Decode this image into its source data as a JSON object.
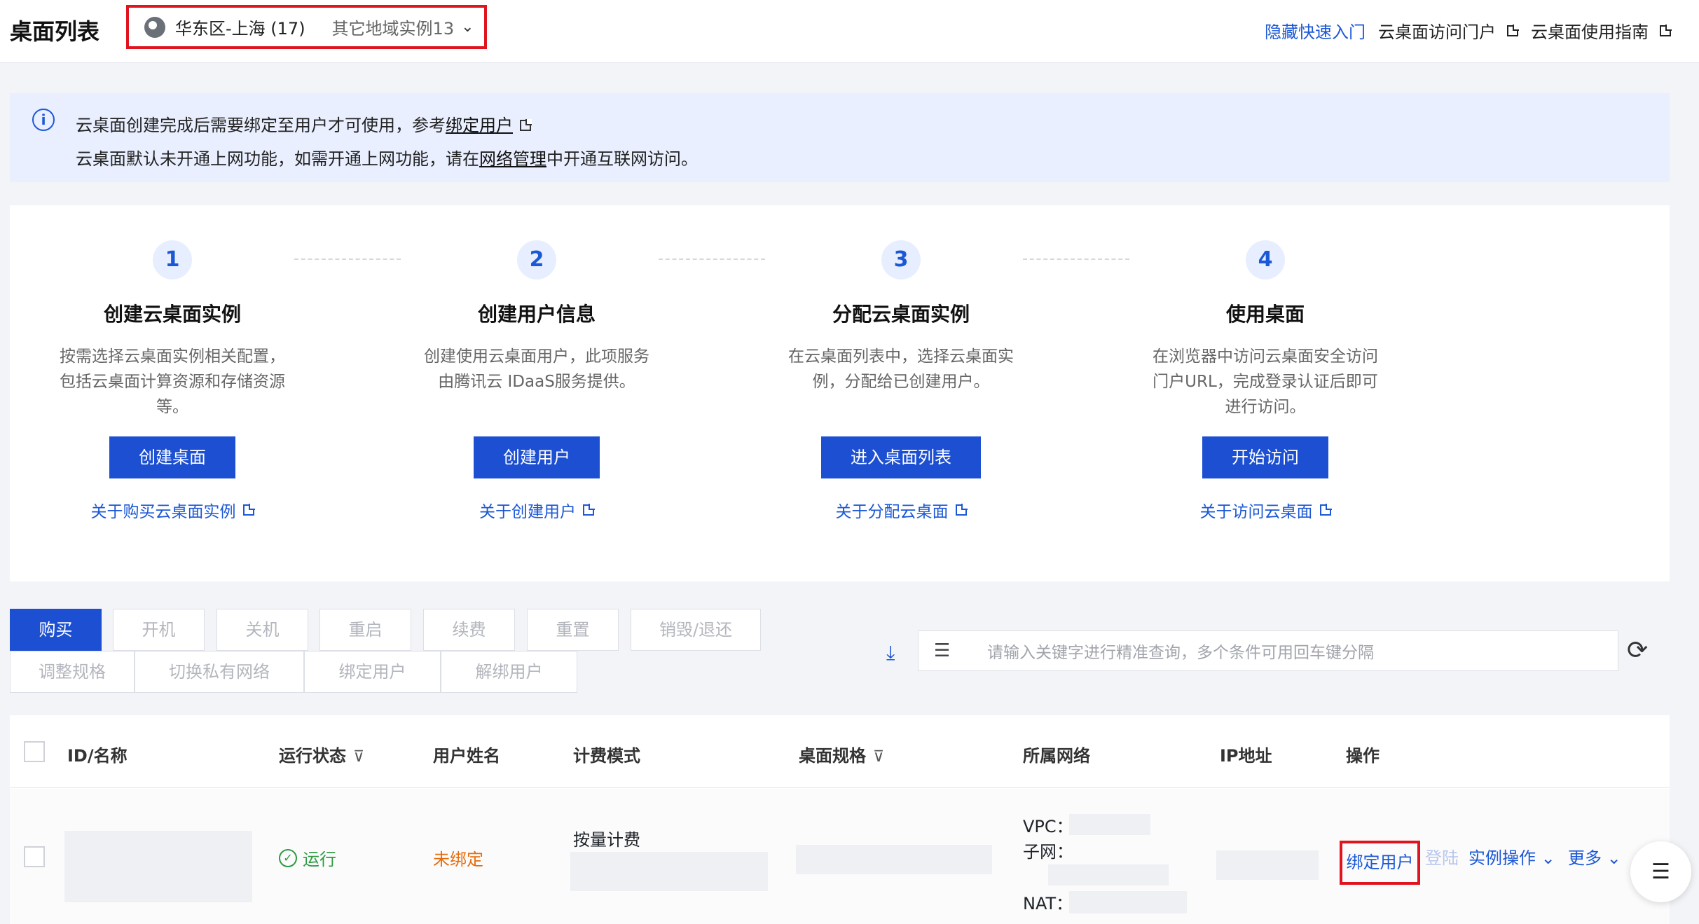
{
  "header": {
    "title": "桌面列表",
    "region_name": "华东区-上海 (17)",
    "region_other": "其它地域实例13",
    "links": [
      "隐藏快速入门",
      "云桌面访问门户",
      "云桌面使用指南"
    ]
  },
  "notice": {
    "line1_prefix": "云桌面创建完成后需要绑定至用户才可使用，参考",
    "line1_link": "绑定用户",
    "line2_prefix": "云桌面默认未开通上网功能，如需开通上网功能，请在",
    "line2_link": "网络管理",
    "line2_suffix": "中开通互联网访问。"
  },
  "steps": [
    {
      "num": "1",
      "title": "创建云桌面实例",
      "desc": "按需选择云桌面实例相关配置，包括云桌面计算资源和存储资源等。",
      "button": "创建桌面",
      "link": "关于购买云桌面实例"
    },
    {
      "num": "2",
      "title": "创建用户信息",
      "desc": "创建使用云桌面用户，此项服务由腾讯云 IDaaS服务提供。",
      "button": "创建用户",
      "link": "关于创建用户"
    },
    {
      "num": "3",
      "title": "分配云桌面实例",
      "desc": "在云桌面列表中，选择云桌面实例，分配给已创建用户。",
      "button": "进入桌面列表",
      "link": "关于分配云桌面"
    },
    {
      "num": "4",
      "title": "使用桌面",
      "desc": "在浏览器中访问云桌面安全访问门户URL，完成登录认证后即可进行访问。",
      "button": "开始访问",
      "link": "关于访问云桌面"
    }
  ],
  "toolbar": {
    "row1": [
      "购买",
      "开机",
      "关机",
      "重启",
      "续费",
      "重置",
      "销毁/退还"
    ],
    "row2": [
      "调整规格",
      "切换私有网络",
      "绑定用户",
      "解绑用户"
    ]
  },
  "search": {
    "placeholder": "请输入关键字进行精准查询，多个条件可用回车键分隔"
  },
  "table": {
    "headers": [
      "ID/名称",
      "运行状态",
      "用户姓名",
      "计费模式",
      "桌面规格",
      "所属网络",
      "IP地址",
      "操作"
    ],
    "row": {
      "status": "运行",
      "user": "未绑定",
      "billing": "按量计费",
      "network_vpc": "VPC：",
      "network_subnet": "子网：",
      "network_nat": "NAT：",
      "action_bind": "绑定用户",
      "action_login": "登陆",
      "action_ops": "实例操作",
      "action_more": "更多"
    }
  }
}
